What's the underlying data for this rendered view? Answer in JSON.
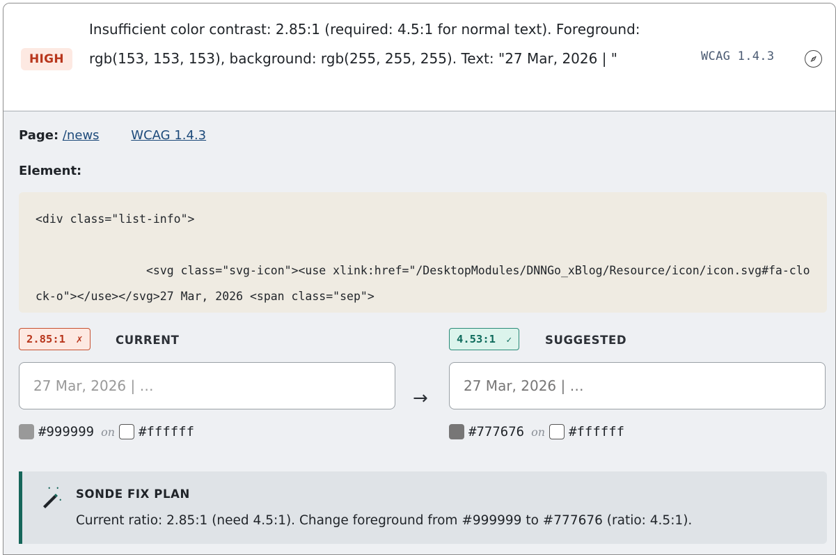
{
  "issue": {
    "severity": "HIGH",
    "title": "Insufficient color contrast: 2.85:1 (required: 4.5:1 for normal text). Foreground: rgb(153, 153, 153), background: rgb(255, 255, 255). Text: \"27 Mar, 2026 | \"",
    "criterion": "WCAG 1.4.3",
    "expand_icon": "compass-icon"
  },
  "details": {
    "page_label": "Page:",
    "page_link": "/news",
    "criterion_link": "WCAG 1.4.3",
    "element_label": "Element:",
    "code": "<div class=\"list-info\">\n\n                <svg class=\"svg-icon\"><use xlink:href=\"/DesktopModules/DNNGo_xBlog/Resource/icon/icon.svg#fa-clock-o\"></use></svg>27 Mar, 2026 <span class=\"sep\">"
  },
  "current": {
    "ratio": "2.85:1",
    "mark": "✗",
    "label": "CURRENT",
    "preview_text": "27 Mar, 2026 | …",
    "fg": "#999999",
    "bg": "#ffffff",
    "on": "on"
  },
  "suggested": {
    "ratio": "4.53:1",
    "mark": "✓",
    "label": "SUGGESTED",
    "preview_text": "27 Mar, 2026 | …",
    "fg": "#777676",
    "bg": "#ffffff",
    "on": "on"
  },
  "arrow": "→",
  "fix": {
    "icon": "magic-wand-icon",
    "title": "SONDE FIX PLAN",
    "text": "Current ratio: 2.85:1 (need 4.5:1). Change foreground from #999999 to #777676 (ratio: 4.5:1)."
  },
  "colors": {
    "high": "#b8361c",
    "good": "#0f6b5c",
    "accent": "#16665a"
  }
}
